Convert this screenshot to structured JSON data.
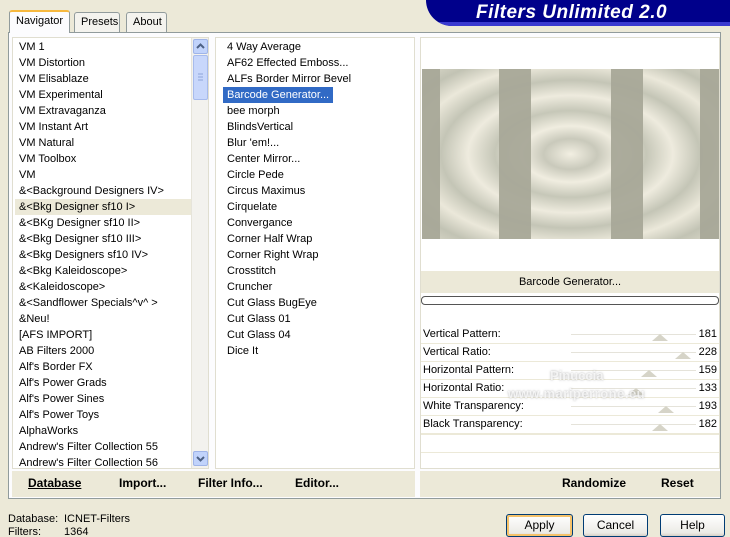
{
  "app": {
    "title": "Filters Unlimited 2.0"
  },
  "tabs": [
    {
      "label": "Navigator",
      "active": true
    },
    {
      "label": "Presets",
      "active": false
    },
    {
      "label": "About",
      "active": false
    }
  ],
  "categories": [
    "VM 1",
    "VM Distortion",
    "VM Elisablaze",
    "VM Experimental",
    "VM Extravaganza",
    "VM Instant Art",
    "VM Natural",
    "VM Toolbox",
    "VM",
    "&<Background Designers IV>",
    "&<Bkg Designer sf10 I>",
    "&<BKg Designer sf10 II>",
    "&<Bkg Designer sf10 III>",
    "&<Bkg Designers sf10 IV>",
    "&<Bkg Kaleidoscope>",
    "&<Kaleidoscope>",
    "&<Sandflower Specials^v^ >",
    "&Neu!",
    "[AFS IMPORT]",
    "AB Filters 2000",
    "Alf's Border FX",
    "Alf's Power Grads",
    "Alf's Power Sines",
    "Alf's Power Toys",
    "AlphaWorks",
    "Andrew's Filter Collection 55",
    "Andrew's Filter Collection 56"
  ],
  "categories_selected": "&<Bkg Designer sf10 I>",
  "filters": [
    "4 Way Average",
    "AF62 Effected Emboss...",
    "ALFs Border Mirror Bevel",
    "Barcode Generator...",
    "bee morph",
    "BlindsVertical",
    "Blur 'em!...",
    "Center Mirror...",
    "Circle Pede",
    "Circus Maximus",
    "Cirquelate",
    "Convergance",
    "Corner Half Wrap",
    "Corner Right Wrap",
    "Crosstitch",
    "Cruncher",
    "Cut Glass  BugEye",
    "Cut Glass 01",
    "Cut Glass 04",
    "Dice It"
  ],
  "filters_selected": "Barcode Generator...",
  "bottom_links": {
    "database": "Database",
    "import": "Import...",
    "filter_info": "Filter Info...",
    "editor": "Editor..."
  },
  "filter_name": "Barcode Generator...",
  "params": [
    {
      "label": "Vertical Pattern:",
      "value": 181
    },
    {
      "label": "Vertical Ratio:",
      "value": 228
    },
    {
      "label": "Horizontal Pattern:",
      "value": 159
    },
    {
      "label": "Horizontal Ratio:",
      "value": 133
    },
    {
      "label": "White Transparency:",
      "value": 193
    },
    {
      "label": "Black Transparency:",
      "value": 182
    }
  ],
  "param_max": 255,
  "randomize_label": "Randomize",
  "reset_label": "Reset",
  "watermark": {
    "line1": "Pinuccia",
    "line2": "www.mariperrone.eu"
  },
  "status": {
    "database_label": "Database:",
    "database_value": "ICNET-Filters",
    "filters_label": "Filters:",
    "filters_value": "1364"
  },
  "buttons": {
    "apply": "Apply",
    "cancel": "Cancel",
    "help": "Help"
  },
  "colors": {
    "banner": "#00008b",
    "selection": "#316ac5",
    "tab_accent": "#f7b93f"
  }
}
